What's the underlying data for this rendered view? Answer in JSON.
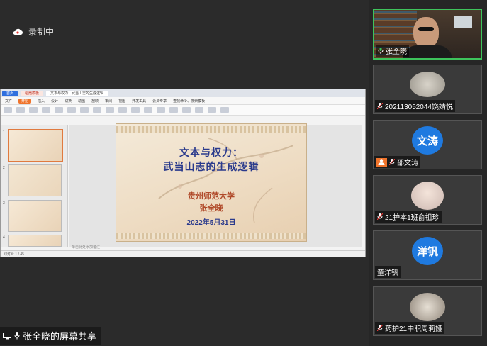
{
  "recording": {
    "label": "录制中"
  },
  "share_banner": {
    "label": "张全晓的屏幕共享"
  },
  "wps": {
    "tabs": [
      "首页",
      "稻壳模板",
      "文本与权力：武当山志的生成逻辑"
    ],
    "menus": [
      "文件",
      "开始",
      "插入",
      "设计",
      "切换",
      "动画",
      "放映",
      "审阅",
      "视图",
      "开发工具",
      "会员专享",
      "查找命令、搜索模板"
    ],
    "highlight_menu": "开始",
    "status_left": "幻灯片 1 / 45",
    "notes_placeholder": "单击此处添加备注",
    "thumb_numbers": [
      "1",
      "2",
      "3",
      "4"
    ]
  },
  "slide": {
    "title_line1": "文本与权力：",
    "title_line2": "武当山志的生成逻辑",
    "university": "贵州师范大学",
    "author": "张全晓",
    "date": "2022年5月31日"
  },
  "participants": [
    {
      "name": "张全晓",
      "avatar_text": "",
      "type": "video",
      "active": true,
      "mic": "on"
    },
    {
      "name": "202113052044饶婧悦",
      "avatar_text": "",
      "type": "photo",
      "active": false,
      "mic": "muted"
    },
    {
      "name": "邵文涛",
      "avatar_text": "文涛",
      "type": "text",
      "active": false,
      "mic": "muted"
    },
    {
      "name": "21护本1班俞祖珍",
      "avatar_text": "",
      "type": "photo",
      "active": false,
      "mic": "muted"
    },
    {
      "name": "童洋钒",
      "avatar_text": "洋钒",
      "type": "text",
      "active": false,
      "mic": "none"
    },
    {
      "name": "药护21中职周莉娅",
      "avatar_text": "",
      "type": "photo",
      "active": false,
      "mic": "muted"
    }
  ],
  "colors": {
    "accent_green": "#3ec45c",
    "avatar_blue": "#1f7ae0",
    "slide_blue": "#2a3a8c",
    "slide_red": "#b04a2a"
  }
}
